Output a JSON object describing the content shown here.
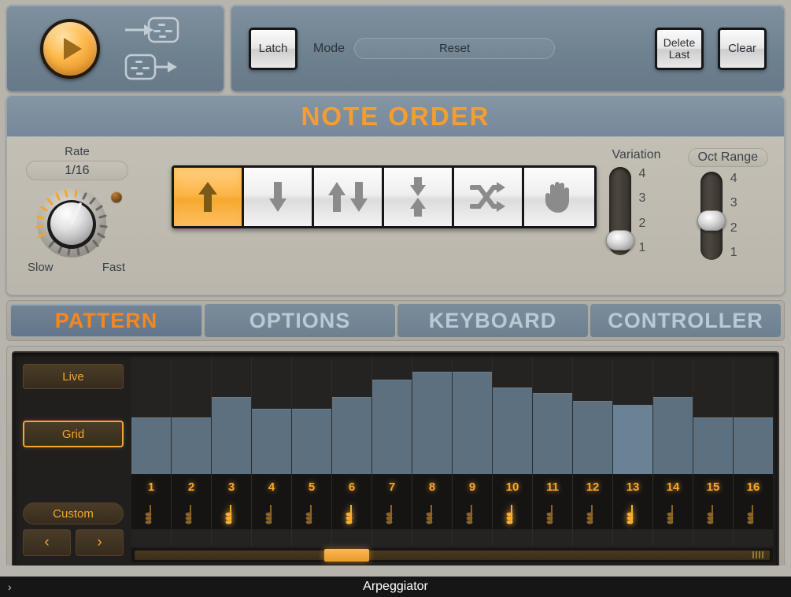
{
  "transport": {
    "play_button": "play-button",
    "midi_in_icon": "midi-in-icon",
    "midi_out_icon": "midi-out-icon"
  },
  "controls": {
    "latch_label": "Latch",
    "mode_label": "Mode",
    "mode_value": "Reset",
    "delete_last_line1": "Delete",
    "delete_last_line2": "Last",
    "clear_label": "Clear"
  },
  "note_order": {
    "title": "NOTE ORDER",
    "rate": {
      "label": "Rate",
      "value": "1/16",
      "min_label": "Slow",
      "max_label": "Fast"
    },
    "directions": [
      {
        "name": "up",
        "active": true
      },
      {
        "name": "down",
        "active": false
      },
      {
        "name": "up-down",
        "active": false
      },
      {
        "name": "down-up",
        "active": false
      },
      {
        "name": "random",
        "active": false
      },
      {
        "name": "as-played",
        "active": false
      }
    ],
    "variation": {
      "label": "Variation",
      "ticks": [
        "4",
        "3",
        "2",
        "1"
      ],
      "value": 1
    },
    "oct_range": {
      "label": "Oct Range",
      "ticks": [
        "4",
        "3",
        "2",
        "1"
      ],
      "value": 2
    }
  },
  "tabs": [
    {
      "label": "PATTERN",
      "active": true
    },
    {
      "label": "OPTIONS",
      "active": false
    },
    {
      "label": "KEYBOARD",
      "active": false
    },
    {
      "label": "CONTROLLER",
      "active": false
    }
  ],
  "pattern": {
    "live_label": "Live",
    "grid_label": "Grid",
    "custom_label": "Custom",
    "prev_label": "‹",
    "next_label": "›",
    "scroll_position_pct": 30,
    "scroll_thumb_width_pct": 7
  },
  "chart_data": {
    "type": "bar",
    "title": "Pattern Step Velocities",
    "categories": [
      "1",
      "2",
      "3",
      "4",
      "5",
      "6",
      "7",
      "8",
      "9",
      "10",
      "11",
      "12",
      "13",
      "14",
      "15",
      "16"
    ],
    "values": [
      72,
      72,
      98,
      83,
      83,
      98,
      120,
      130,
      130,
      110,
      103,
      93,
      88,
      98,
      72,
      72
    ],
    "highlight_index": 12,
    "ylim": [
      0,
      148
    ],
    "xlabel": "",
    "ylabel": "",
    "grid": false,
    "bar_color": "#5c7080",
    "highlight_color": "#6a8293",
    "step_icons": [
      {
        "step": "1",
        "bright": false
      },
      {
        "step": "2",
        "bright": false
      },
      {
        "step": "3",
        "bright": true
      },
      {
        "step": "4",
        "bright": false
      },
      {
        "step": "5",
        "bright": false
      },
      {
        "step": "6",
        "bright": true
      },
      {
        "step": "7",
        "bright": false
      },
      {
        "step": "8",
        "bright": false
      },
      {
        "step": "9",
        "bright": false
      },
      {
        "step": "10",
        "bright": true
      },
      {
        "step": "11",
        "bright": false
      },
      {
        "step": "12",
        "bright": false
      },
      {
        "step": "13",
        "bright": true
      },
      {
        "step": "14",
        "bright": false
      },
      {
        "step": "15",
        "bright": false
      },
      {
        "step": "16",
        "bright": false
      }
    ]
  },
  "footer": {
    "title": "Arpeggiator",
    "arrow": "›"
  },
  "colors": {
    "accent_orange": "#f6871f",
    "title_orange": "#f59d2e",
    "panel_blue": "#76889a",
    "panel_grey": "#bab6ac",
    "bar_blue": "#5c7080"
  }
}
